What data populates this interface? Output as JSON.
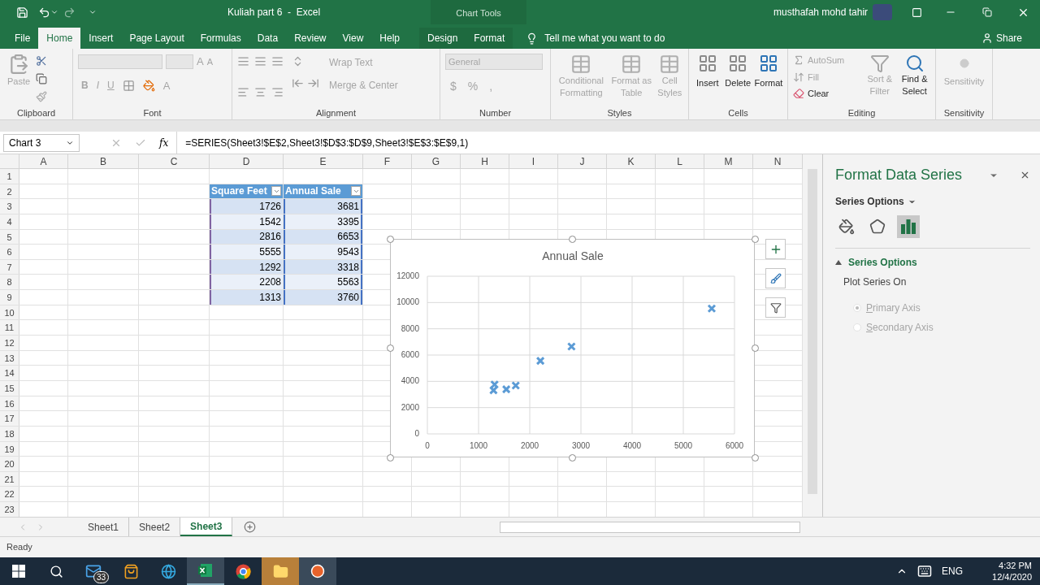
{
  "title_bar": {
    "document_title": "Kuliah part 6  -  Excel",
    "context_label": "Chart Tools",
    "user_name": "musthafah mohd tahir"
  },
  "ribbon_tabs": [
    {
      "label": "File",
      "selected": false
    },
    {
      "label": "Home",
      "selected": true
    },
    {
      "label": "Insert",
      "selected": false
    },
    {
      "label": "Page Layout",
      "selected": false
    },
    {
      "label": "Formulas",
      "selected": false
    },
    {
      "label": "Data",
      "selected": false
    },
    {
      "label": "Review",
      "selected": false
    },
    {
      "label": "View",
      "selected": false
    },
    {
      "label": "Help",
      "selected": false
    }
  ],
  "context_tabs": [
    {
      "label": "Design",
      "selected": false
    },
    {
      "label": "Format",
      "selected": false
    }
  ],
  "tell_me": "Tell me what you want to do",
  "share": "Share",
  "ribbon": {
    "clipboard": {
      "name": "Clipboard",
      "paste": "Paste"
    },
    "font": {
      "name": "Font",
      "styles": [
        "B",
        "I",
        "U"
      ],
      "size_letters": [
        "A",
        "A"
      ],
      "color_letter": "A"
    },
    "alignment": {
      "name": "Alignment",
      "wrap": "Wrap Text",
      "merge": "Merge & Center"
    },
    "number": {
      "name": "Number",
      "format": "General",
      "symbols": [
        "$",
        "%",
        ","
      ]
    },
    "styles": {
      "name": "Styles",
      "buttons": [
        {
          "label": "Conditional Formatting",
          "disabled": true
        },
        {
          "label": "Format as Table",
          "disabled": true
        },
        {
          "label": "Cell Styles",
          "disabled": true
        }
      ]
    },
    "cells": {
      "name": "Cells",
      "buttons": [
        {
          "label": "Insert",
          "disabled": false
        },
        {
          "label": "Delete",
          "disabled": false
        },
        {
          "label": "Format",
          "disabled": false
        }
      ]
    },
    "editing": {
      "name": "Editing",
      "small": [
        {
          "label": "AutoSum",
          "disabled": true
        },
        {
          "label": "Fill",
          "disabled": true
        },
        {
          "label": "Clear",
          "disabled": false
        }
      ],
      "large": [
        {
          "label": "Sort & Filter",
          "disabled": true
        },
        {
          "label": "Find & Select",
          "disabled": false
        }
      ]
    },
    "sensitivity": {
      "name": "Sensitivity",
      "button": {
        "label": "Sensitivity",
        "disabled": true
      }
    }
  },
  "formula_bar": {
    "name_box": "Chart 3",
    "function_label": "fx",
    "formula": "=SERIES(Sheet3!$E$2,Sheet3!$D$3:$D$9,Sheet3!$E$3:$E$9,1)"
  },
  "columns": [
    "A",
    "B",
    "C",
    "D",
    "E",
    "F",
    "G",
    "H",
    "I",
    "J",
    "K",
    "L",
    "M",
    "N"
  ],
  "row_numbers": [
    "1",
    "2",
    "3",
    "4",
    "5",
    "6",
    "7",
    "8",
    "9",
    "10",
    "11",
    "12",
    "13",
    "14",
    "15",
    "16",
    "17",
    "18",
    "19",
    "20",
    "21",
    "22",
    "23"
  ],
  "table": {
    "columns": [
      "Square Feet",
      "Annual Sale"
    ],
    "rows": [
      [
        "1726",
        "3681"
      ],
      [
        "1542",
        "3395"
      ],
      [
        "2816",
        "6653"
      ],
      [
        "5555",
        "9543"
      ],
      [
        "1292",
        "3318"
      ],
      [
        "2208",
        "5563"
      ],
      [
        "1313",
        "3760"
      ]
    ]
  },
  "chart": {
    "chart_data": {
      "type": "scatter",
      "title": "Annual Sale",
      "x": [
        1726,
        1542,
        2816,
        5555,
        1292,
        2208,
        1313
      ],
      "grid": true,
      "series": [
        {
          "color": "#5b9bd5",
          "values": [
            3681,
            3395,
            6653,
            9543,
            3318,
            5563,
            3760
          ]
        }
      ],
      "xlim": [
        0,
        6000
      ],
      "ylim": [
        0,
        12000
      ],
      "xticks": [
        0,
        1000,
        2000,
        3000,
        4000,
        5000,
        6000
      ],
      "yticks": [
        0,
        2000,
        4000,
        6000,
        8000,
        10000,
        12000
      ]
    }
  },
  "format_pane": {
    "title": "Format Data Series",
    "options_menu": "Series Options",
    "icon_tabs": [
      {
        "kind": "fill",
        "selected": false
      },
      {
        "kind": "effects",
        "selected": false
      },
      {
        "kind": "options",
        "selected": true
      }
    ],
    "section": {
      "label": "Series Options",
      "expanded": true
    },
    "subheading": "Plot Series On",
    "radios": [
      {
        "label": "Primary Axis",
        "selected": true,
        "disabled": true
      },
      {
        "label": "Secondary Axis",
        "selected": false,
        "disabled": true
      }
    ]
  },
  "sheet_tabs": [
    {
      "label": "Sheet1",
      "selected": false
    },
    {
      "label": "Sheet2",
      "selected": false
    },
    {
      "label": "Sheet3",
      "selected": true
    }
  ],
  "status": "Ready",
  "taskbar": {
    "mail_badge": "33",
    "language": "ENG",
    "time": "4:32 PM",
    "date": "12/4/2020"
  }
}
